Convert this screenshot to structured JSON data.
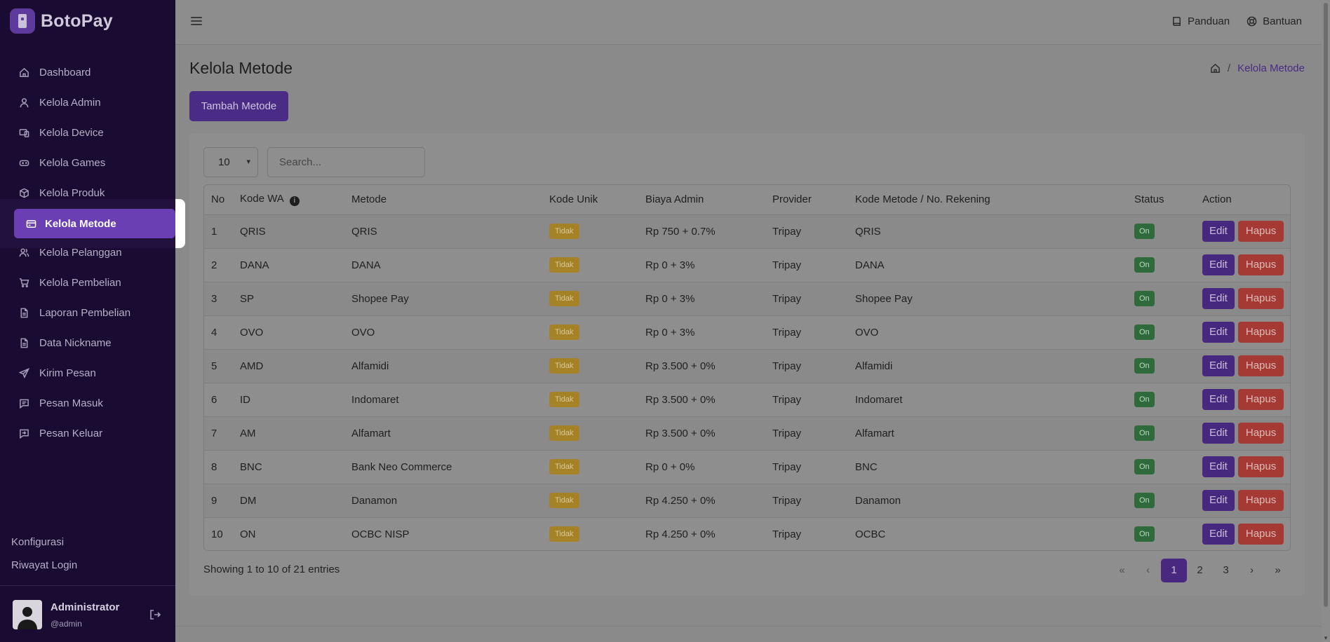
{
  "brand": {
    "name": "BotoPay"
  },
  "sidebar": {
    "items": [
      {
        "label": "Dashboard",
        "icon": "home-icon"
      },
      {
        "label": "Kelola Admin",
        "icon": "user-icon"
      },
      {
        "label": "Kelola Device",
        "icon": "devices-icon"
      },
      {
        "label": "Kelola Games",
        "icon": "gamepad-icon"
      },
      {
        "label": "Kelola Produk",
        "icon": "box-icon"
      },
      {
        "label": "Kelola Metode",
        "icon": "credit-card-icon",
        "active": true
      },
      {
        "label": "Kelola Pelanggan",
        "icon": "users-icon"
      },
      {
        "label": "Kelola Pembelian",
        "icon": "cart-icon"
      },
      {
        "label": "Laporan Pembelian",
        "icon": "document-icon"
      },
      {
        "label": "Data Nickname",
        "icon": "document-icon"
      },
      {
        "label": "Kirim Pesan",
        "icon": "send-icon"
      },
      {
        "label": "Pesan Masuk",
        "icon": "message-icon"
      },
      {
        "label": "Pesan Keluar",
        "icon": "message-out-icon"
      }
    ],
    "footer_links": [
      "Konfigurasi",
      "Riwayat Login"
    ],
    "user": {
      "name": "Administrator",
      "handle": "@admin"
    }
  },
  "topbar": {
    "links": [
      {
        "label": "Panduan",
        "icon": "book-icon"
      },
      {
        "label": "Bantuan",
        "icon": "lifebuoy-icon"
      }
    ]
  },
  "page": {
    "title": "Kelola Metode",
    "breadcrumb_current": "Kelola Metode",
    "add_button": "Tambah Metode"
  },
  "table_controls": {
    "length": "10",
    "search_placeholder": "Search..."
  },
  "table": {
    "headers": [
      "No",
      "Kode WA",
      "Metode",
      "Kode Unik",
      "Biaya Admin",
      "Provider",
      "Kode Metode / No. Rekening",
      "Status",
      "Action"
    ],
    "rows": [
      {
        "no": "1",
        "kode_wa": "QRIS",
        "metode": "QRIS",
        "kode_unik": "Tidak",
        "biaya": "Rp 750 + 0.7%",
        "provider": "Tripay",
        "rekening": "QRIS",
        "status": "On"
      },
      {
        "no": "2",
        "kode_wa": "DANA",
        "metode": "DANA",
        "kode_unik": "Tidak",
        "biaya": "Rp 0 + 3%",
        "provider": "Tripay",
        "rekening": "DANA",
        "status": "On"
      },
      {
        "no": "3",
        "kode_wa": "SP",
        "metode": "Shopee Pay",
        "kode_unik": "Tidak",
        "biaya": "Rp 0 + 3%",
        "provider": "Tripay",
        "rekening": "Shopee Pay",
        "status": "On"
      },
      {
        "no": "4",
        "kode_wa": "OVO",
        "metode": "OVO",
        "kode_unik": "Tidak",
        "biaya": "Rp 0 + 3%",
        "provider": "Tripay",
        "rekening": "OVO",
        "status": "On"
      },
      {
        "no": "5",
        "kode_wa": "AMD",
        "metode": "Alfamidi",
        "kode_unik": "Tidak",
        "biaya": "Rp 3.500 + 0%",
        "provider": "Tripay",
        "rekening": "Alfamidi",
        "status": "On"
      },
      {
        "no": "6",
        "kode_wa": "ID",
        "metode": "Indomaret",
        "kode_unik": "Tidak",
        "biaya": "Rp 3.500 + 0%",
        "provider": "Tripay",
        "rekening": "Indomaret",
        "status": "On"
      },
      {
        "no": "7",
        "kode_wa": "AM",
        "metode": "Alfamart",
        "kode_unik": "Tidak",
        "biaya": "Rp 3.500 + 0%",
        "provider": "Tripay",
        "rekening": "Alfamart",
        "status": "On"
      },
      {
        "no": "8",
        "kode_wa": "BNC",
        "metode": "Bank Neo Commerce",
        "kode_unik": "Tidak",
        "biaya": "Rp 0 + 0%",
        "provider": "Tripay",
        "rekening": "BNC",
        "status": "On"
      },
      {
        "no": "9",
        "kode_wa": "DM",
        "metode": "Danamon",
        "kode_unik": "Tidak",
        "biaya": "Rp 4.250 + 0%",
        "provider": "Tripay",
        "rekening": "Danamon",
        "status": "On"
      },
      {
        "no": "10",
        "kode_wa": "ON",
        "metode": "OCBC NISP",
        "kode_unik": "Tidak",
        "biaya": "Rp 4.250 + 0%",
        "provider": "Tripay",
        "rekening": "OCBC",
        "status": "On"
      }
    ],
    "edit_label": "Edit",
    "delete_label": "Hapus",
    "info_text": "Showing 1 to 10 of 21 entries"
  },
  "pagination": {
    "first": "«",
    "prev": "‹",
    "pages": [
      "1",
      "2",
      "3"
    ],
    "current": "1",
    "next": "›",
    "last": "»"
  },
  "colors": {
    "sidebar_bg": "#1a0b33",
    "accent": "#6a3fb4",
    "badge_tidak": "#a68226",
    "badge_on": "#2f6a3a",
    "danger": "#a53a34"
  }
}
